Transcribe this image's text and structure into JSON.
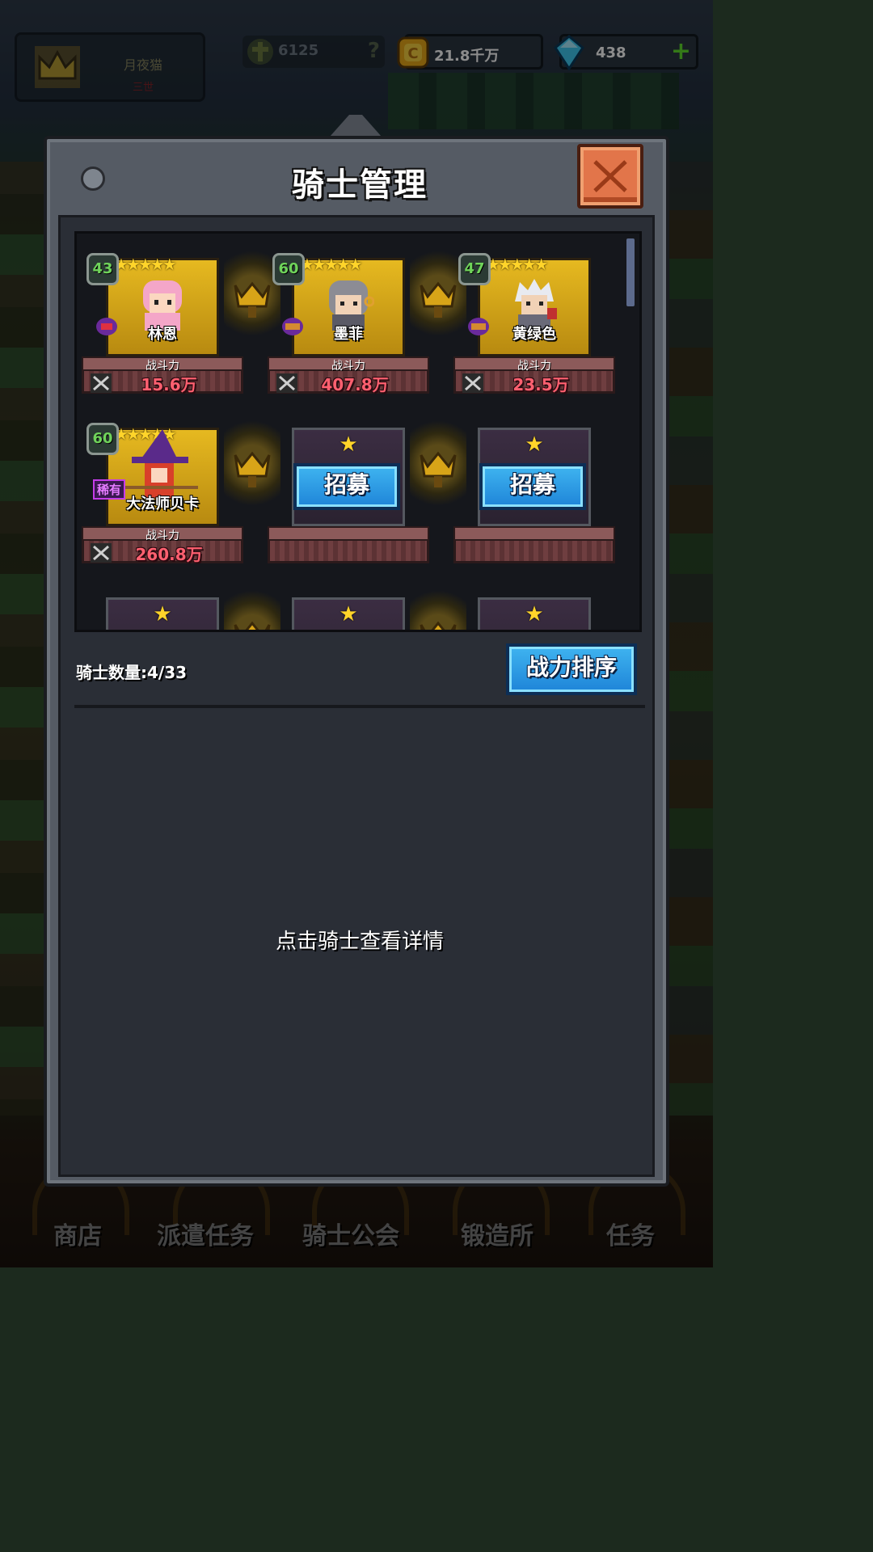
{
  "top_bar": {
    "player_name": "月夜猫",
    "player_title": "三世",
    "power": "6125",
    "help": "?",
    "gold": "21.8千万",
    "gems": "438",
    "add": "+"
  },
  "modal": {
    "title": "骑士管理",
    "power_label": "战斗力",
    "recruit_label": "招募",
    "count_label": "骑士数量:4/33",
    "sort_label": "战力排序",
    "hint": "点击骑士查看详情",
    "knights": [
      {
        "level": "43",
        "name": "林恩",
        "power": "15.6万",
        "stars": "★★★★★"
      },
      {
        "level": "60",
        "name": "墨菲",
        "power": "407.8万",
        "stars": "★★★★★"
      },
      {
        "level": "47",
        "name": "黄绿色",
        "power": "23.5万",
        "stars": "★★★★★"
      },
      {
        "level": "60",
        "name": "大法师贝卡",
        "power": "260.8万",
        "stars": "★★★★★",
        "rarity": "稀有"
      }
    ],
    "empty_star": "★"
  },
  "bottom_nav": {
    "items": [
      "商店",
      "派遣任务",
      "骑士公会",
      "锻造所",
      "任务"
    ]
  },
  "colors": {
    "accent_blue": "#1e84d8",
    "gold": "#e6b920",
    "close_orange": "#e2754a",
    "power_red": "#ff6070"
  }
}
